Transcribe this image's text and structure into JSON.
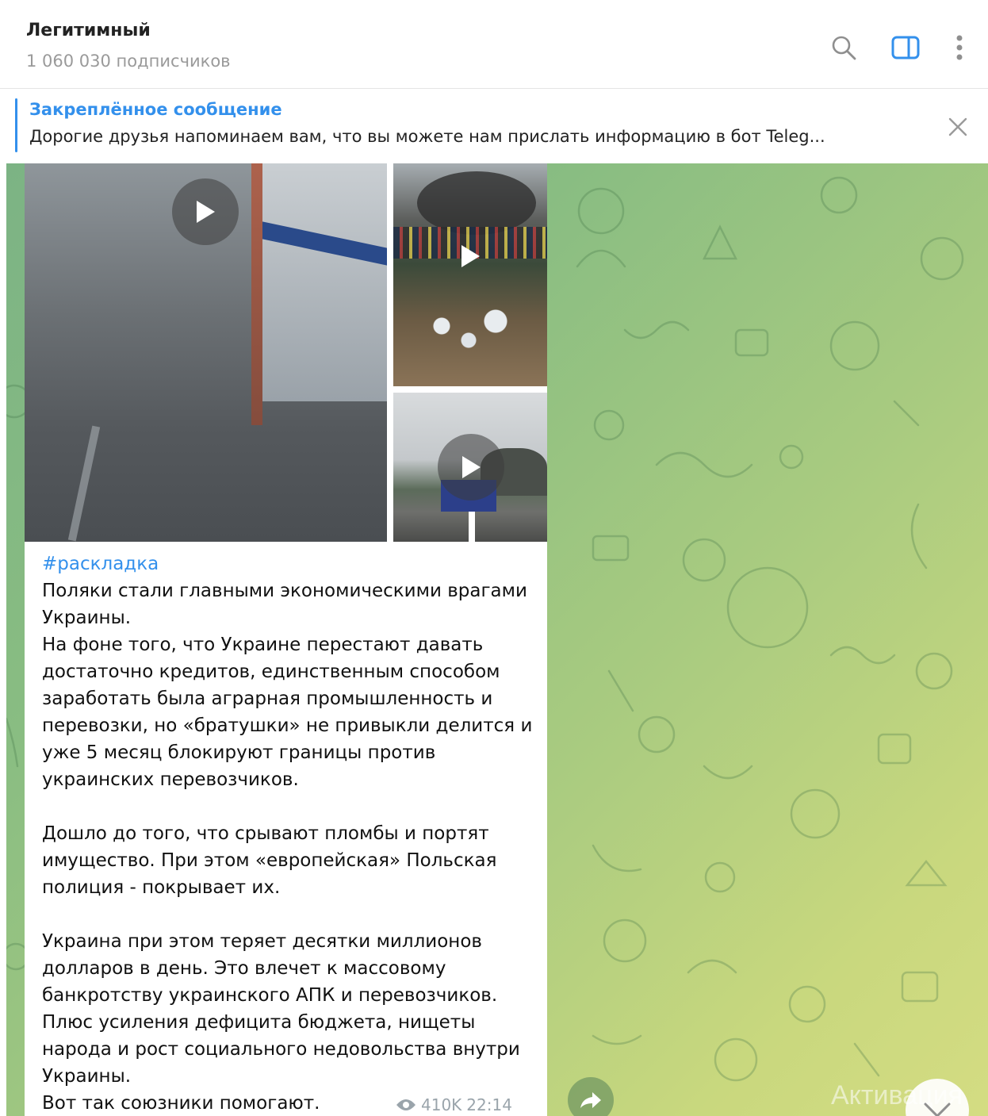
{
  "header": {
    "title": "Легитимный",
    "subscribers": "1 060 030 подписчиков"
  },
  "pinned": {
    "label": "Закреплённое сообщение",
    "text": "Дорогие друзья напоминаем вам, что вы можете нам прислать информацию в бот Teleg..."
  },
  "message": {
    "hashtag": "#раскладка",
    "body": "Поляки стали главными экономическими врагами Украины.\nНа фоне того, что Украине перестают давать достаточно кредитов, единственным способом заработать была аграрная промышленность и перевозки, но «братушки» не привыкли делится и уже 5 месяц блокируют границы против украинских перевозчиков.\n\nДошло до того, что срывают пломбы и портят имущество. При этом «европейская» Польская полиция - покрывает их.\n\nУкраина при этом теряет десятки миллионов долларов в день. Это влечет к массовому банкротству украинского АПК и перевозчиков. Плюс усиления дефицита бюджета, нищеты народа и рост социального недовольства внутри Украины.\nВот так союзники помогают.",
    "views": "410K",
    "time": "22:14"
  },
  "watermark": "Активация",
  "icons": {
    "search": "search-icon",
    "sidebar": "sidebar-toggle-icon",
    "more": "more-vertical-icon",
    "close": "close-icon",
    "play": "play-icon",
    "views": "eye-icon",
    "forward": "forward-icon",
    "scroll": "chevron-down-icon"
  },
  "colors": {
    "accent": "#3390ec",
    "meta": "#9aa4ab"
  }
}
